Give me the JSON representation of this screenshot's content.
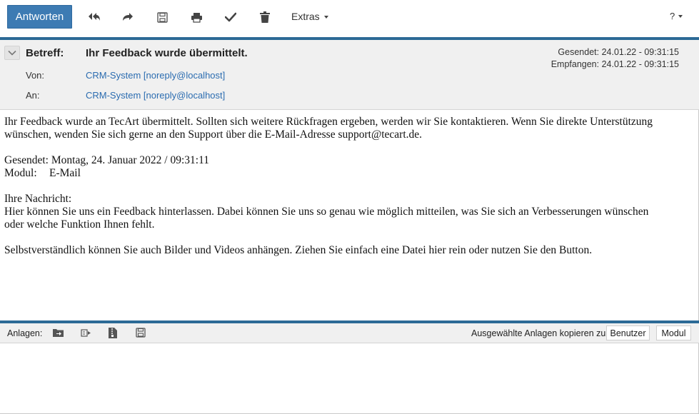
{
  "toolbar": {
    "reply_label": "Antworten",
    "icons": [
      "reply-all-icon",
      "forward-icon",
      "save-icon",
      "print-icon",
      "check-icon",
      "trash-icon"
    ],
    "extras_label": "Extras",
    "help_label": "?"
  },
  "header": {
    "subject_label": "Betreff:",
    "subject": "Ihr Feedback wurde übermittelt.",
    "from_label": "Von:",
    "from": "CRM-System [noreply@localhost]",
    "to_label": "An:",
    "to": "CRM-System [noreply@localhost]",
    "sent": "Gesendet: 24.01.22 - 09:31:15",
    "received": "Empfangen: 24.01.22 - 09:31:15"
  },
  "body": {
    "para1_line1": "Ihr Feedback wurde an TecArt übermittelt. Sollten sich weitere Rückfragen ergeben, werden wir Sie kontaktieren. Wenn Sie direkte Unterstützung",
    "para1_line2": "wünschen, wenden Sie sich gerne an den Support über die E-Mail-Adresse support@tecart.de.",
    "sent_line": "Gesendet: Montag, 24. Januar 2022 / 09:31:11",
    "module_label": "Modul:",
    "module_value": "E-Mail",
    "your_message_label": "Ihre Nachricht:",
    "msg_line1": "Hier können Sie uns ein Feedback hinterlassen. Dabei können Sie uns so genau wie möglich mitteilen, was Sie sich an Verbesserungen wünschen",
    "msg_line2": "oder welche Funktion Ihnen fehlt.",
    "msg_line3": "Selbstverständlich können Sie auch Bilder und Videos anhängen. Ziehen Sie einfach eine Datei hier rein oder nutzen Sie den Button."
  },
  "attachments": {
    "label": "Anlagen:",
    "icons": [
      "move-to-folder-icon",
      "export-icon",
      "zip-file-icon",
      "save-icon"
    ],
    "copy_label": "Ausgewählte Anlagen kopieren zu:",
    "user_button": "Benutzer",
    "module_button": "Modul"
  },
  "colors": {
    "accent": "#3d7bb3",
    "divider": "#2c6a96",
    "link": "#2b6cb0",
    "header_bg": "#f0f0f0"
  }
}
